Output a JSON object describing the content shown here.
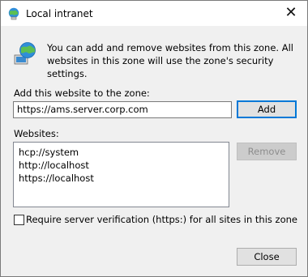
{
  "window": {
    "title": "Local intranet",
    "close_glyph": "✕",
    "title_icon": "globe-network-icon"
  },
  "info": {
    "icon": "globe-computer-icon",
    "description": "You can add and remove websites from this zone. All websites in this zone will use the zone's security settings."
  },
  "add_section": {
    "label": "Add this website to the zone:",
    "url_value": "https://ams.server.corp.com",
    "add_button": "Add"
  },
  "websites": {
    "label": "Websites:",
    "items": [
      "hcp://system",
      "http://localhost",
      "https://localhost"
    ],
    "remove_button": "Remove"
  },
  "verification": {
    "checked": false,
    "label": "Require server verification (https:) for all sites in this zone"
  },
  "footer": {
    "close_button": "Close"
  },
  "colors": {
    "accent": "#0078d7",
    "window_bg": "#f0f0f0",
    "title_bg": "#ffffff"
  }
}
